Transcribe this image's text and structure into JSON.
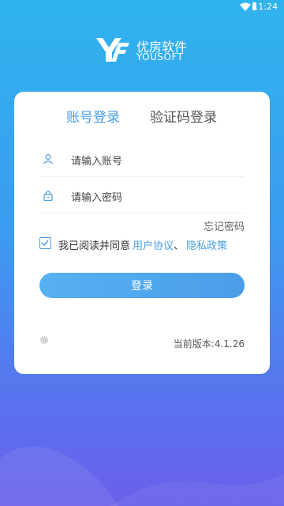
{
  "status_bar": {
    "time": "11:24"
  },
  "brand": {
    "name": "优房软件",
    "name_en": "YOUSOFT"
  },
  "tabs": [
    {
      "label": "账号登录",
      "active": true
    },
    {
      "label": "验证码登录",
      "active": false
    }
  ],
  "form": {
    "account_placeholder": "请输入账号",
    "password_placeholder": "请输入密码",
    "forgot_password": "忘记密码"
  },
  "agreement": {
    "checked": true,
    "text": "我已阅读并同意",
    "user_agreement": "用户协议",
    "separator": "、",
    "privacy_policy": "隐私政策"
  },
  "login_button": "登录",
  "version": "当前版本:4.1.26",
  "colors": {
    "accent": "#4a9de8",
    "gradient_top": "#2fb3ee",
    "gradient_bottom": "#6a5fea"
  }
}
